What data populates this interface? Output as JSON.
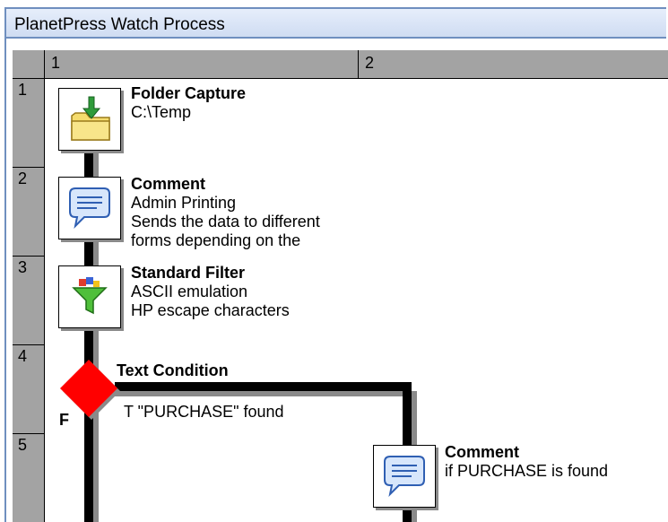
{
  "window": {
    "title": "PlanetPress Watch Process"
  },
  "columns": [
    "1",
    "2"
  ],
  "rows": [
    "1",
    "2",
    "3",
    "4",
    "5"
  ],
  "tasks": [
    {
      "id": "folder-capture",
      "title": "Folder Capture",
      "lines": [
        "C:\\Temp"
      ],
      "icon": "folder-capture-icon"
    },
    {
      "id": "comment-admin",
      "title": "Comment",
      "lines": [
        "Admin Printing",
        "Sends the data to different",
        "forms depending on the"
      ],
      "icon": "comment-icon"
    },
    {
      "id": "standard-filter",
      "title": "Standard Filter",
      "lines": [
        "ASCII emulation",
        "HP escape characters"
      ],
      "icon": "funnel-filter-icon"
    },
    {
      "id": "text-condition",
      "title": "Text Condition",
      "true_label": "T \"PURCHASE\" found",
      "false_label": "F",
      "icon": "condition-diamond-icon"
    },
    {
      "id": "comment-purchase",
      "title": "Comment",
      "lines": [
        "if PURCHASE is found"
      ],
      "icon": "comment-icon"
    }
  ],
  "colors": {
    "titlebar_border": "#6f8fbf",
    "header_gray": "#a3a3a3",
    "diamond_red": "#ff0000",
    "flow_line": "#000000"
  }
}
